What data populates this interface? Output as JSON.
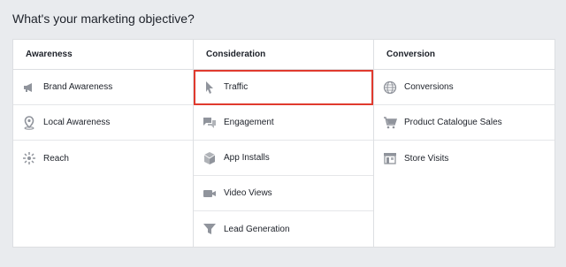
{
  "heading": "What's your marketing objective?",
  "columns": [
    {
      "title": "Awareness",
      "items": [
        {
          "label": "Brand Awareness",
          "icon": "megaphone-icon"
        },
        {
          "label": "Local Awareness",
          "icon": "location-pin-icon"
        },
        {
          "label": "Reach",
          "icon": "reach-burst-icon"
        }
      ]
    },
    {
      "title": "Consideration",
      "items": [
        {
          "label": "Traffic",
          "icon": "cursor-icon",
          "selected": true
        },
        {
          "label": "Engagement",
          "icon": "chat-bubbles-icon"
        },
        {
          "label": "App Installs",
          "icon": "box-icon"
        },
        {
          "label": "Video Views",
          "icon": "video-camera-icon"
        },
        {
          "label": "Lead Generation",
          "icon": "funnel-icon"
        }
      ]
    },
    {
      "title": "Conversion",
      "items": [
        {
          "label": "Conversions",
          "icon": "globe-icon"
        },
        {
          "label": "Product Catalogue Sales",
          "icon": "shopping-cart-icon"
        },
        {
          "label": "Store Visits",
          "icon": "store-icon"
        }
      ]
    }
  ],
  "colors": {
    "icon": "#90949c",
    "selected_outline": "#e03a2e",
    "background": "#e9ebee"
  }
}
